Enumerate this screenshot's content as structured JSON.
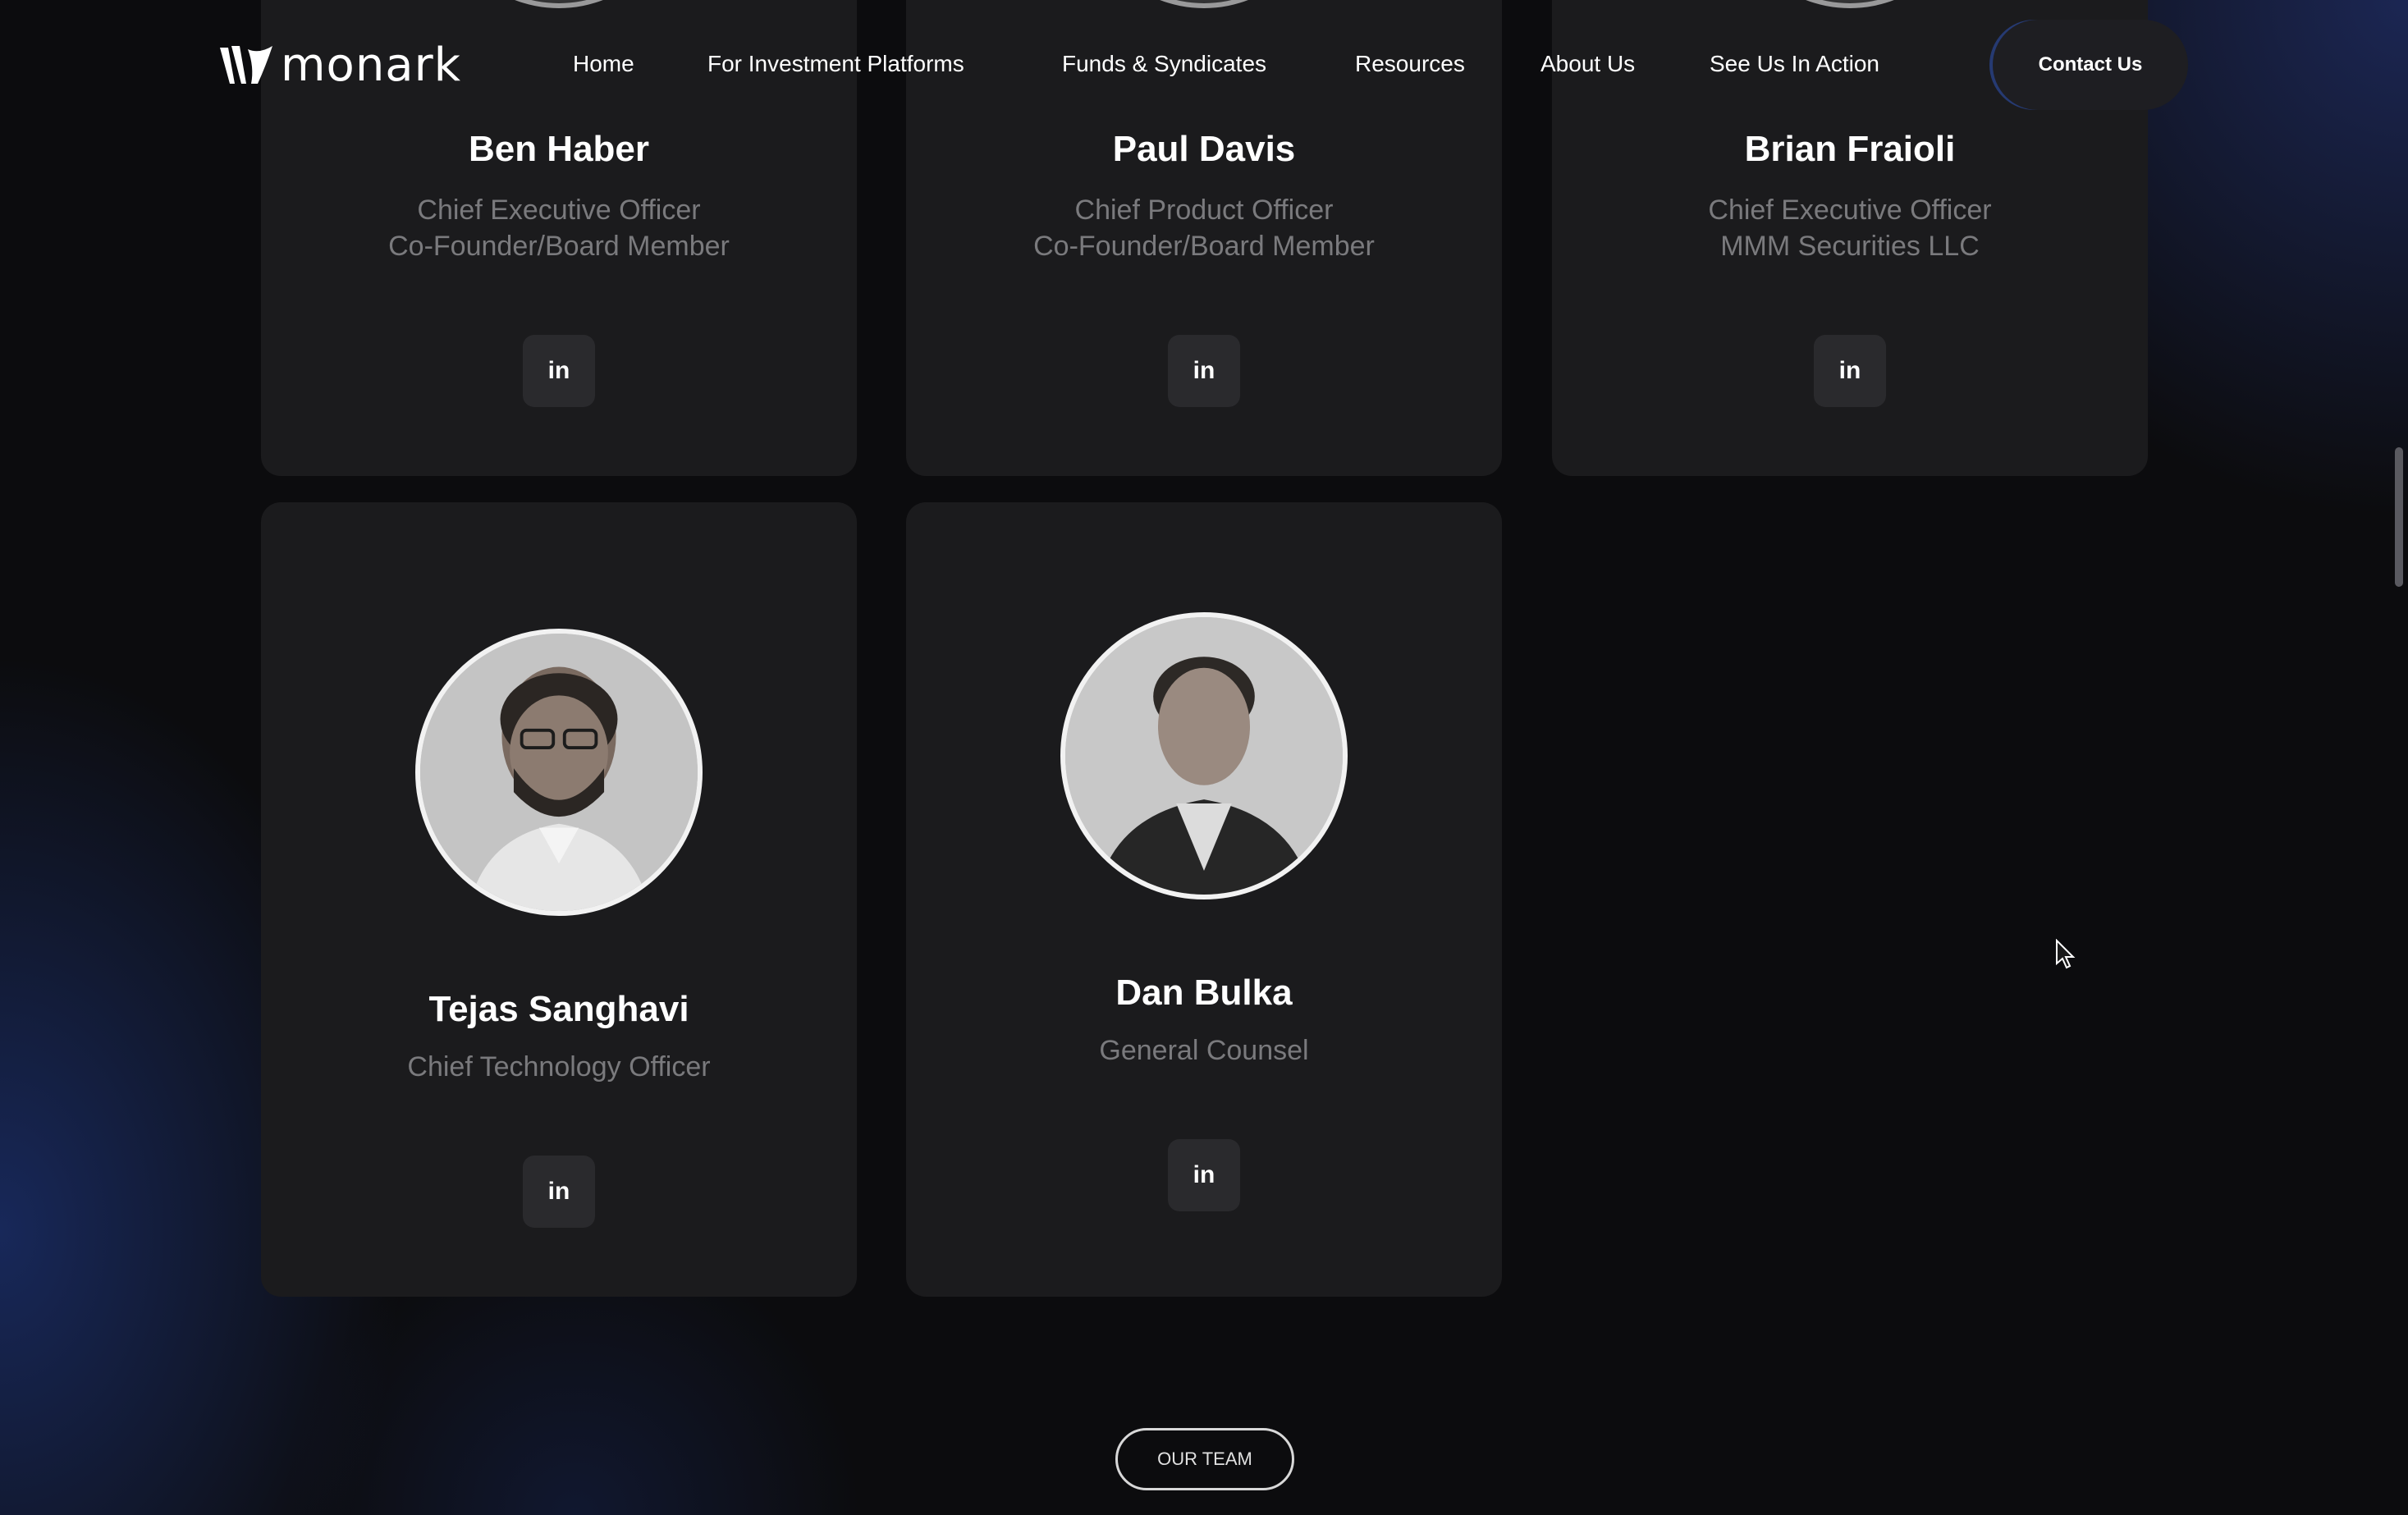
{
  "header": {
    "logo_text": "monark",
    "nav": [
      {
        "label": "Home"
      },
      {
        "label": "For Investment Platforms"
      },
      {
        "label": "Funds & Syndicates"
      },
      {
        "label": "Resources"
      },
      {
        "label": "About Us"
      },
      {
        "label": "See Us In Action"
      }
    ],
    "contact_label": "Contact Us"
  },
  "team": [
    {
      "name": "Ben Haber",
      "role_lines": [
        "Chief Executive Officer",
        "Co-Founder/Board Member"
      ],
      "linkedin_label": "in"
    },
    {
      "name": "Paul Davis",
      "role_lines": [
        "Chief Product Officer",
        "Co-Founder/Board Member"
      ],
      "linkedin_label": "in"
    },
    {
      "name": "Brian Fraioli",
      "role_lines": [
        "Chief Executive Officer",
        "MMM Securities LLC"
      ],
      "linkedin_label": "in"
    },
    {
      "name": "Tejas Sanghavi",
      "role_lines": [
        "Chief Technology Officer"
      ],
      "linkedin_label": "in"
    },
    {
      "name": "Dan Bulka",
      "role_lines": [
        "General Counsel"
      ],
      "linkedin_label": "in"
    }
  ],
  "our_team_button": "OUR TEAM",
  "colors": {
    "background": "#0c0c0e",
    "card": "#1b1b1d",
    "text_primary": "#ffffff",
    "text_secondary": "#7a7a7d",
    "accent_glow": "#2a4aa0"
  }
}
